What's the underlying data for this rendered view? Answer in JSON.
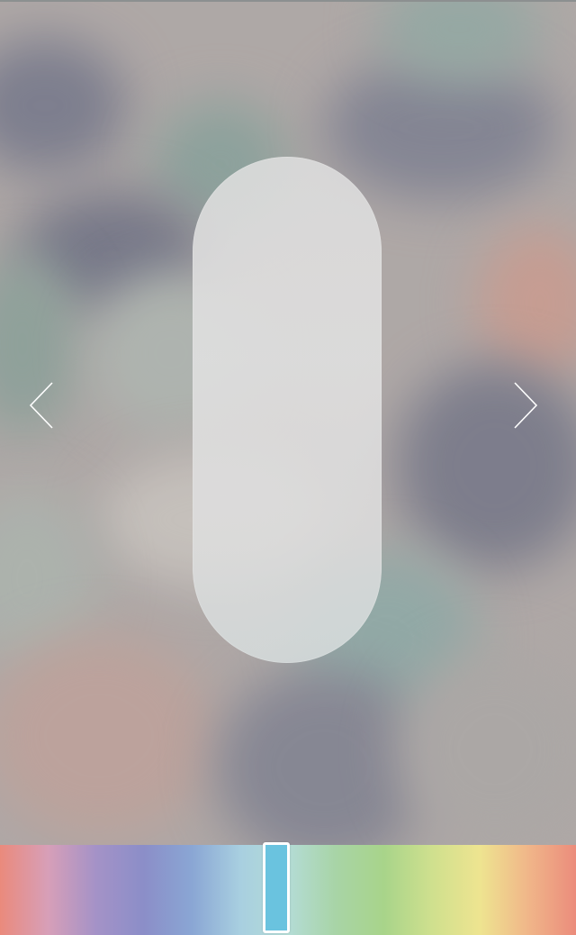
{
  "icons": {
    "prev": "chevron-left-icon",
    "next": "chevron-right-icon"
  },
  "colors": {
    "accent_selected": "#6ac3df",
    "thumb_border": "#ffffff",
    "spectrum_stops": [
      "#ea8a7c",
      "#d79fb8",
      "#a492c7",
      "#8b8ec8",
      "#8aa6d4",
      "#a8cfe0",
      "#b4dcd6",
      "#a8d4a6",
      "#a8d48a",
      "#cfe08e",
      "#eee490",
      "#f0b689",
      "#eb8c7c"
    ]
  },
  "color_picker": {
    "selected_position": 0.48
  }
}
